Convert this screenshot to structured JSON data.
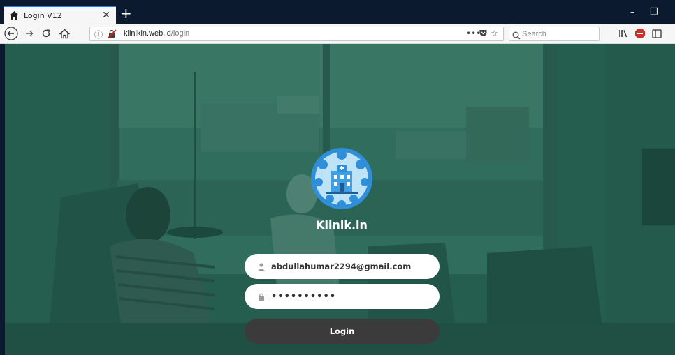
{
  "browser": {
    "tab": {
      "title": "Login V12",
      "close": "✕"
    },
    "newtab": "+",
    "window_controls": {
      "minimize": "–",
      "restore": "❐"
    },
    "url": {
      "host": "klinikin.web.id",
      "path": "/login",
      "more": "•••"
    },
    "search": {
      "placeholder": "Search"
    }
  },
  "page": {
    "brand": "Klinik.in",
    "email": {
      "value": "abdullahumar2294@gmail.com"
    },
    "password": {
      "value": "••••••••••"
    },
    "login_label": "Login"
  },
  "colors": {
    "background_tint": "#2c6a5a",
    "login_button": "#3b3b3b",
    "logo_blue": "#2f8fd8",
    "tab_accent": "#2d7af0"
  }
}
